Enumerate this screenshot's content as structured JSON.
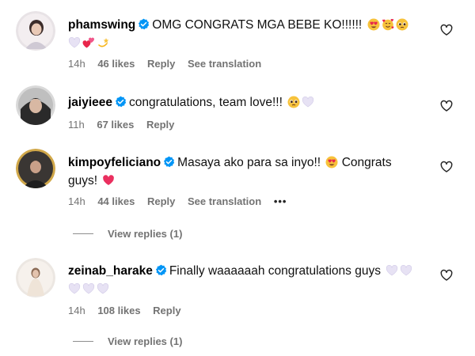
{
  "comments": [
    {
      "username": "phamswing",
      "text": "OMG CONGRATS MGA BEBE KO!!!!!!",
      "emoji_inline": [
        "heart-eyes",
        "smiling-hearts",
        "pleading-face"
      ],
      "emoji_second_line": [
        "white-heart",
        "two-hearts",
        "dizzy"
      ],
      "time": "14h",
      "likes": "46 likes",
      "reply": "Reply",
      "translation": "See translation"
    },
    {
      "username": "jaiyieee",
      "text": "congratulations, team love!!!",
      "emoji_inline": [
        "pleading-face",
        "white-heart"
      ],
      "time": "11h",
      "likes": "67 likes",
      "reply": "Reply"
    },
    {
      "username": "kimpoyfeliciano",
      "text": "Masaya ako para sa inyo!!",
      "text2": "Congrats",
      "text3": "guys!",
      "time": "14h",
      "likes": "44 likes",
      "reply": "Reply",
      "translation": "See translation",
      "more": "•••",
      "view_replies": "View replies (1)"
    },
    {
      "username": "zeinab_harake",
      "text": "Finally waaaaaah congratulations guys",
      "time": "14h",
      "likes": "108 likes",
      "reply": "Reply",
      "view_replies": "View replies (1)"
    }
  ],
  "colors": {
    "verified": "#0095f6",
    "meta": "#737373",
    "line": "#8e8e8e"
  },
  "icons": {
    "like": "heart-outline-icon",
    "verified": "verified-badge-icon"
  }
}
